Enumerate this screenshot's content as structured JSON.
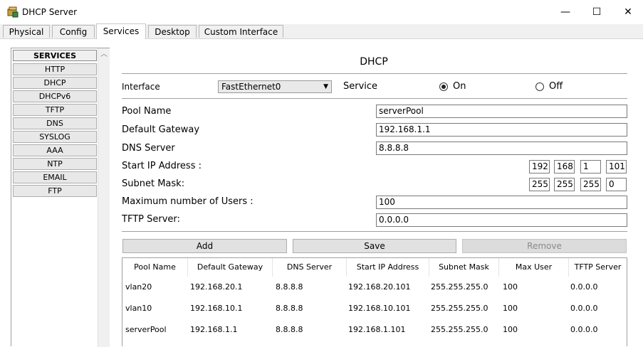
{
  "window": {
    "title": "DHCP Server",
    "min": "—",
    "max": "☐",
    "close": "✕"
  },
  "tabs": [
    {
      "label": "Physical"
    },
    {
      "label": "Config"
    },
    {
      "label": "Services"
    },
    {
      "label": "Desktop"
    },
    {
      "label": "Custom Interface"
    }
  ],
  "services": {
    "header": "SERVICES",
    "items": [
      "HTTP",
      "DHCP",
      "DHCPv6",
      "TFTP",
      "DNS",
      "SYSLOG",
      "AAA",
      "NTP",
      "EMAIL",
      "FTP"
    ]
  },
  "dhcp": {
    "title": "DHCP",
    "interface_label": "Interface",
    "interface_value": "FastEthernet0",
    "service_label": "Service",
    "on_label": "On",
    "off_label": "Off",
    "service_state": "On",
    "pool_name_label": "Pool Name",
    "pool_name_value": "serverPool",
    "gateway_label": "Default Gateway",
    "gateway_value": "192.168.1.1",
    "dns_label": "DNS Server",
    "dns_value": "8.8.8.8",
    "start_ip_label": "Start IP Address :",
    "start_ip": [
      "192",
      "168",
      "1",
      "101"
    ],
    "subnet_label": "Subnet Mask:",
    "subnet": [
      "255",
      "255",
      "255",
      "0"
    ],
    "max_users_label": "Maximum number of Users :",
    "max_users_value": "100",
    "tftp_label": "TFTP Server:",
    "tftp_value": "0.0.0.0",
    "add_label": "Add",
    "save_label": "Save",
    "remove_label": "Remove"
  },
  "pool_table": {
    "columns": [
      "Pool Name",
      "Default Gateway",
      "DNS Server",
      "Start IP Address",
      "Subnet Mask",
      "Max User",
      "TFTP Server"
    ],
    "rows": [
      [
        "vlan20",
        "192.168.20.1",
        "8.8.8.8",
        "192.168.20.101",
        "255.255.255.0",
        "100",
        "0.0.0.0"
      ],
      [
        "vlan10",
        "192.168.10.1",
        "8.8.8.8",
        "192.168.10.101",
        "255.255.255.0",
        "100",
        "0.0.0.0"
      ],
      [
        "serverPool",
        "192.168.1.1",
        "8.8.8.8",
        "192.168.1.101",
        "255.255.255.0",
        "100",
        "0.0.0.0"
      ]
    ]
  },
  "colors": {
    "accent_on": "#222222",
    "tab_active_bg": "#ffffff",
    "button_bg": "#e1e1e1"
  }
}
